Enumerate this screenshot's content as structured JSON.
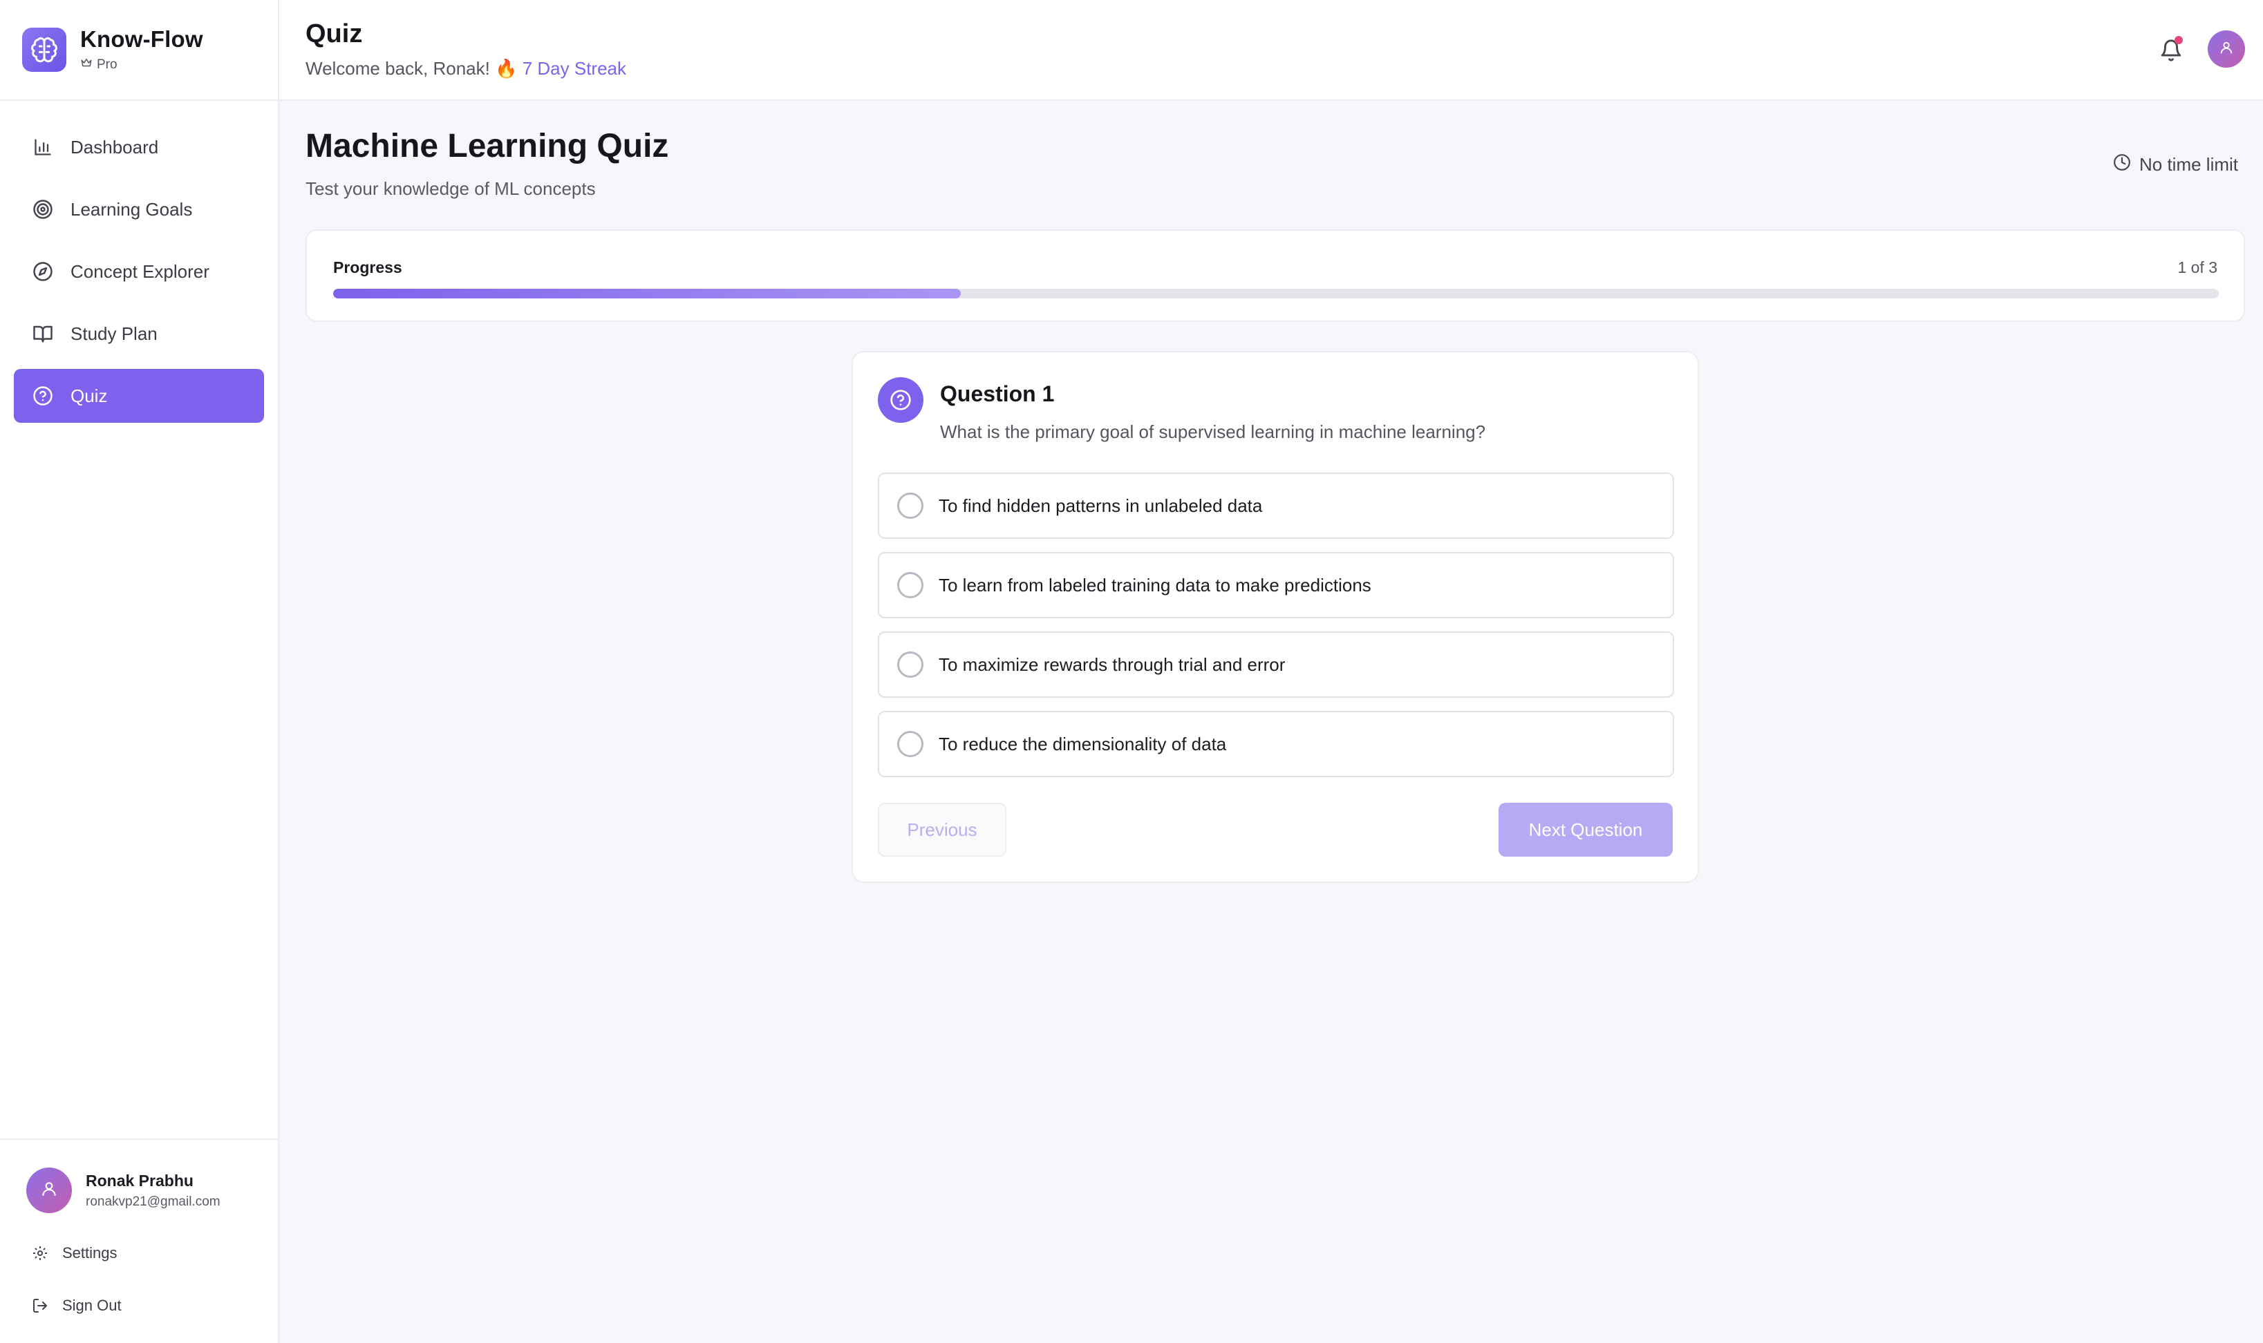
{
  "brand": {
    "name": "Know-Flow",
    "tier": "Pro"
  },
  "sidebar": {
    "items": [
      {
        "label": "Dashboard",
        "icon": "bar-chart-icon"
      },
      {
        "label": "Learning Goals",
        "icon": "target-icon"
      },
      {
        "label": "Concept Explorer",
        "icon": "compass-icon"
      },
      {
        "label": "Study Plan",
        "icon": "book-open-icon"
      },
      {
        "label": "Quiz",
        "icon": "help-circle-icon",
        "active": true
      }
    ]
  },
  "user": {
    "name": "Ronak Prabhu",
    "email": "ronakvp21@gmail.com"
  },
  "footer_links": {
    "settings": "Settings",
    "sign_out": "Sign Out"
  },
  "header": {
    "title": "Quiz",
    "welcome": "Welcome back, Ronak!",
    "streak_emoji": "🔥",
    "streak": "7 Day Streak"
  },
  "quiz": {
    "title": "Machine Learning Quiz",
    "subtitle": "Test your knowledge of ML concepts",
    "time_limit": "No time limit"
  },
  "progress": {
    "label": "Progress",
    "count": "1 of 3",
    "fraction": 0.333
  },
  "question": {
    "title": "Question 1",
    "text": "What is the primary goal of supervised learning in machine learning?",
    "options": [
      "To find hidden patterns in unlabeled data",
      "To learn from labeled training data to make predictions",
      "To maximize rewards through trial and error",
      "To reduce the dimensionality of data"
    ]
  },
  "buttons": {
    "previous": "Previous",
    "next": "Next Question"
  },
  "colors": {
    "accent": "#7c62ec",
    "accent_light": "#b7aaf5",
    "notification": "#e6487a"
  }
}
